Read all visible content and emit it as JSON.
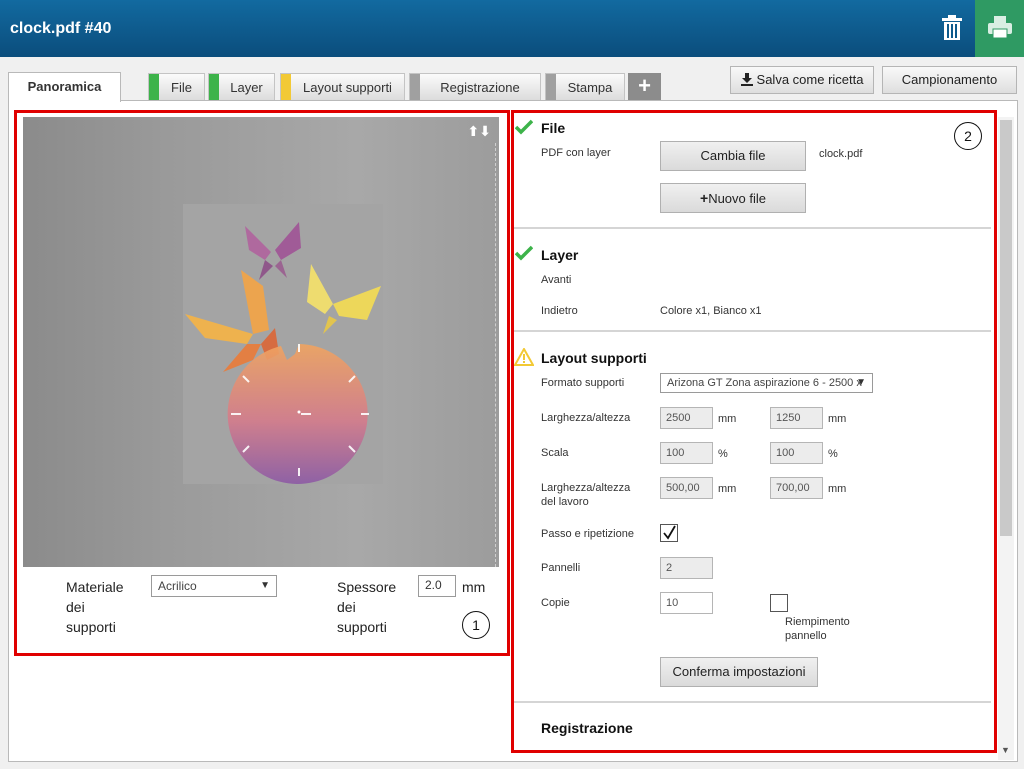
{
  "window": {
    "title": "clock.pdf #40"
  },
  "toolbar": {
    "trash_icon": "trash-icon",
    "print_icon": "printer-icon"
  },
  "tabs": [
    {
      "label": "Panoramica",
      "active": true
    },
    {
      "label": "File",
      "status": "#3db34a"
    },
    {
      "label": "Layer",
      "status": "#3db34a"
    },
    {
      "label": "Layout supporti",
      "status": "#f2c935"
    },
    {
      "label": "Registrazione",
      "status": "#a0a0a0"
    },
    {
      "label": "Stampa",
      "status": "#a0a0a0"
    }
  ],
  "tab_add": "+",
  "actions": {
    "save_recipe": "Salva come ricetta",
    "sampling": "Campionamento"
  },
  "preview": {
    "arrows": "⬆⬇",
    "material_label": "Materiale dei supporti",
    "material_value": "Acrilico",
    "thickness_label": "Spessore dei supporti",
    "thickness_value": "2.0",
    "thickness_unit": "mm",
    "badge": "1"
  },
  "right": {
    "badge": "2",
    "file": {
      "title": "File",
      "pdf_label": "PDF con layer",
      "change_button": "Cambia file",
      "filename": "clock.pdf",
      "new_button": "Nuovo file"
    },
    "layer": {
      "title": "Layer",
      "front_label": "Avanti",
      "back_label": "Indietro",
      "back_value": "Colore x1, Bianco x1"
    },
    "layout": {
      "title": "Layout supporti",
      "format_label": "Formato supporti",
      "format_value": "Arizona GT Zona aspirazione 6 - 2500 x",
      "size_label": "Larghezza/altezza",
      "width": "2500",
      "height": "1250",
      "unit_mm": "mm",
      "scale_label": "Scala",
      "scale_x": "100",
      "scale_y": "100",
      "unit_pct": "%",
      "job_size_label": "Larghezza/altezza del lavoro",
      "job_width": "500,00",
      "job_height": "700,00",
      "step_repeat_label": "Passo e ripetizione",
      "step_repeat_checked": true,
      "panels_label": "Pannelli",
      "panels_value": "2",
      "copies_label": "Copie",
      "copies_value": "10",
      "fill_panel_label": "Riempimento pannello",
      "confirm_button": "Conferma impostazioni"
    },
    "registration": {
      "title": "Registrazione"
    }
  },
  "colors": {
    "titlebar": "#0d5a8c",
    "print": "#2f9a63",
    "highlight": "#e00000",
    "ok": "#3db34a",
    "warn": "#f2c935"
  }
}
